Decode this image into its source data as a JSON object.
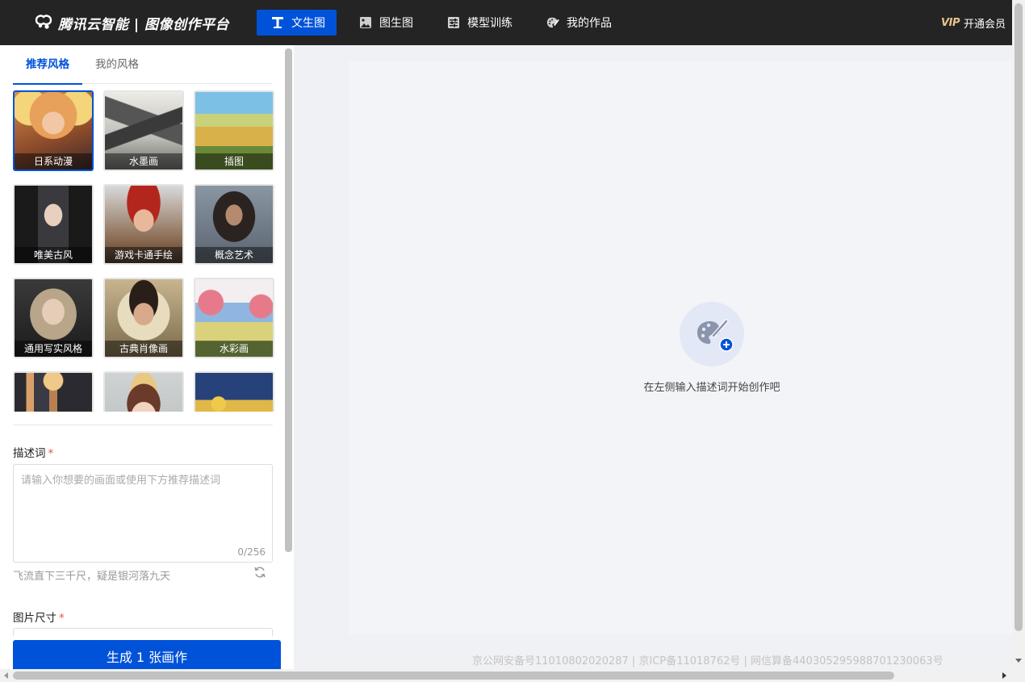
{
  "header": {
    "logo_text": "腾讯云智能 | 图像创作平台",
    "nav": [
      {
        "label": "文生图",
        "icon": "text-t-icon",
        "active": true
      },
      {
        "label": "图生图",
        "icon": "image-icon",
        "active": false
      },
      {
        "label": "模型训练",
        "icon": "sliders-icon",
        "active": false
      },
      {
        "label": "我的作品",
        "icon": "palette-icon",
        "active": false
      }
    ],
    "vip_badge": "VIP",
    "vip_label": "开通会员"
  },
  "left": {
    "tabs": [
      {
        "label": "推荐风格",
        "active": true
      },
      {
        "label": "我的风格",
        "active": false
      }
    ],
    "styles": [
      {
        "label": "日系动漫",
        "selected": true
      },
      {
        "label": "水墨画",
        "selected": false
      },
      {
        "label": "插图",
        "selected": false
      },
      {
        "label": "唯美古风",
        "selected": false
      },
      {
        "label": "游戏卡通手绘",
        "selected": false
      },
      {
        "label": "概念艺术",
        "selected": false
      },
      {
        "label": "通用写实风格",
        "selected": false
      },
      {
        "label": "古典肖像画",
        "selected": false
      },
      {
        "label": "水彩画",
        "selected": false
      },
      {
        "label": "",
        "selected": false
      },
      {
        "label": "",
        "selected": false
      },
      {
        "label": "",
        "selected": false
      }
    ],
    "prompt": {
      "label": "描述词",
      "required_mark": "*",
      "placeholder": "请输入你想要的画面或使用下方推荐描述词",
      "value": "",
      "counter": "0/256",
      "suggestion": "飞流直下三千尺，疑是银河落九天"
    },
    "size": {
      "label": "图片尺寸",
      "required_mark": "*"
    },
    "generate_label": "生成 1 张画作"
  },
  "canvas": {
    "empty_text": "在左侧输入描述词开始创作吧"
  },
  "footer": {
    "text": "京公网安备号11010802020287 | 京ICP备11018762号 | 网信算备440305295988701230063号"
  },
  "colors": {
    "primary": "#0052d9",
    "topbar": "#242424",
    "vip_gold": "#e9c48f",
    "required": "#e34d59"
  }
}
